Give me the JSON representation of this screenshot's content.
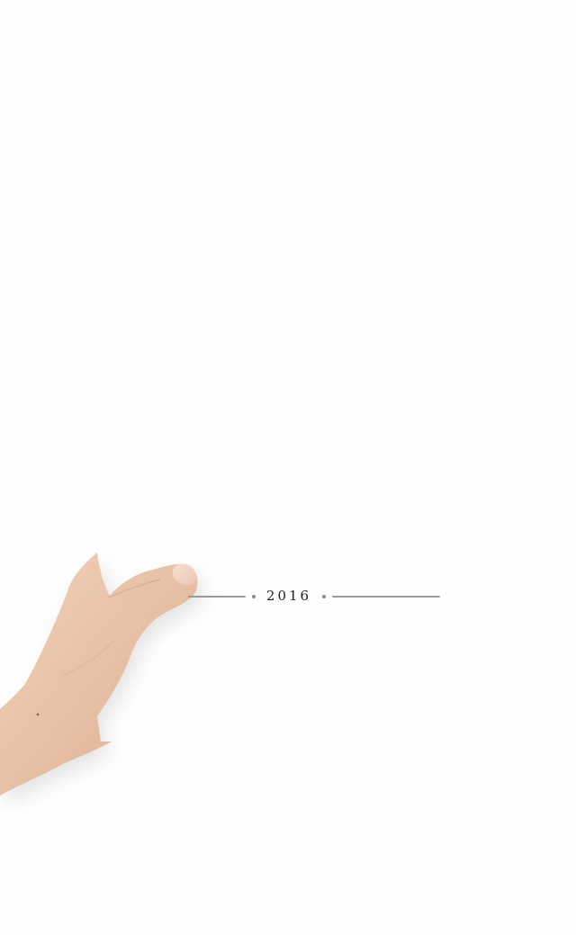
{
  "timeline": {
    "year": "2016"
  },
  "colors": {
    "background": "#fefefe",
    "line": "#9a9a9a",
    "text": "#222222",
    "skin": "#ecc7ae"
  },
  "icons": {
    "hand": "hand-holding-illustration"
  }
}
